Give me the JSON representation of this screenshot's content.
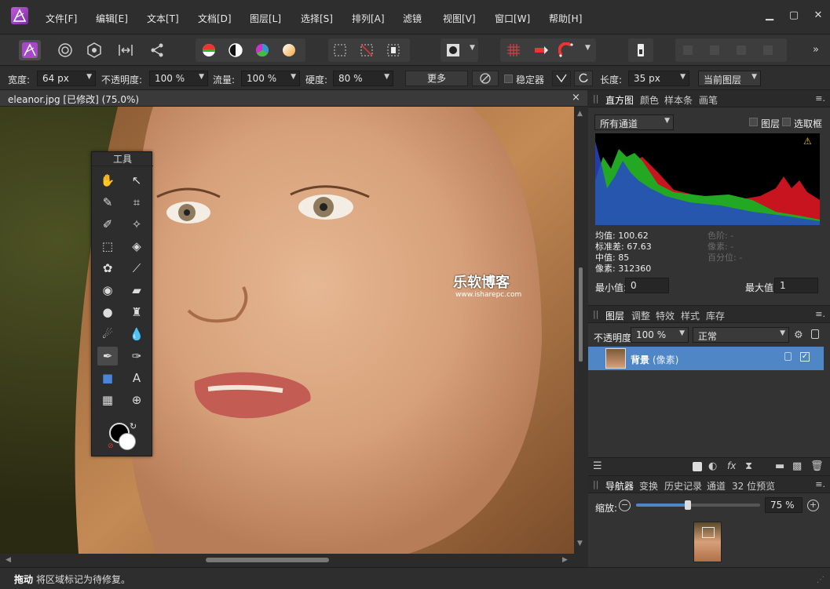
{
  "menu": {
    "items": [
      "文件[F]",
      "编辑[E]",
      "文本[T]",
      "文档[D]",
      "图层[L]",
      "选择[S]",
      "排列[A]",
      "滤镜",
      "视图[V]",
      "窗口[W]",
      "帮助[H]"
    ]
  },
  "context_toolbar": {
    "width_label": "宽度:",
    "width_value": "64 px",
    "opacity_label": "不透明度:",
    "opacity_value": "100 %",
    "flow_label": "流量:",
    "flow_value": "100 %",
    "hardness_label": "硬度:",
    "hardness_value": "80 %",
    "more_label": "更多",
    "stabilizer_label": "稳定器",
    "length_label": "长度:",
    "length_value": "35 px",
    "layer_scope": "当前图层"
  },
  "document": {
    "tab_title": "eleanor.jpg [已修改] (75.0%)",
    "close_glyph": "×"
  },
  "watermark": {
    "brand": "乐软博客",
    "url": "www.isharepc.com"
  },
  "tools_panel": {
    "title": "工具"
  },
  "histogram_panel": {
    "tabs": [
      "直方图",
      "颜色",
      "样本条",
      "画笔"
    ],
    "channel": "所有通道",
    "layer_label": "图层",
    "marquee_label": "选取框",
    "stats_left": [
      "均值: 100.62",
      "标准差: 67.63",
      "中值: 85",
      "像素: 312360"
    ],
    "stats_right": [
      "色阶: -",
      "像素: -",
      "百分位: -"
    ],
    "min_label": "最小值:",
    "min_value": "0",
    "max_label": "最大值:",
    "max_value": "1"
  },
  "layers_panel": {
    "tabs": [
      "图层",
      "调整",
      "特效",
      "样式",
      "库存"
    ],
    "opacity_label": "不透明度:",
    "opacity_value": "100 %",
    "blend_mode": "正常",
    "layer_name": "背景",
    "layer_type": "(像素)"
  },
  "navigator_panel": {
    "tabs": [
      "导航器",
      "变换",
      "历史记录",
      "通道",
      "32 位预览"
    ],
    "zoom_label": "缩放:",
    "zoom_value": "75 %",
    "zoom_fraction": 0.42
  },
  "status": {
    "bold": "拖动",
    "text": "将区域标记为待修复。"
  },
  "colors": {
    "accent": "#4f86c6",
    "panel": "#333333",
    "histogram_green": "#22a822",
    "histogram_red": "#c8141e",
    "histogram_blue": "#2848c8"
  }
}
